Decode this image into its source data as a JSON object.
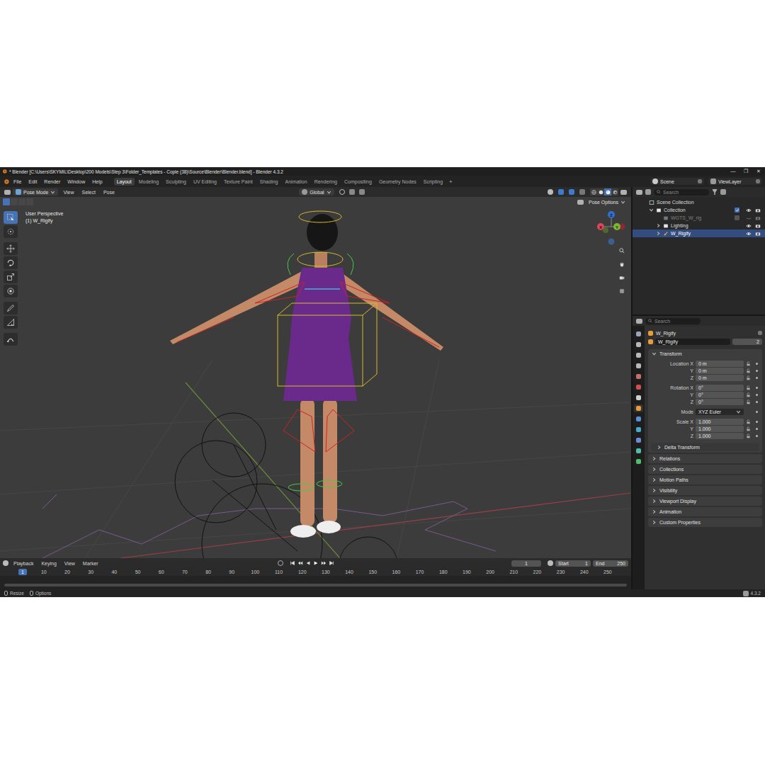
{
  "window": {
    "title": "* Blender [C:\\Users\\SKYMIL\\Desktop\\200 Models\\Step 3\\Folder_Templates - Copie (38)\\Source\\Blender\\Blender.blend] - Blender 4.3.2",
    "controls": [
      "—",
      "❐",
      "✕"
    ]
  },
  "menu": [
    "File",
    "Edit",
    "Render",
    "Window",
    "Help"
  ],
  "workspaces": [
    {
      "label": "Layout",
      "selected": true
    },
    {
      "label": "Modeling",
      "selected": false
    },
    {
      "label": "Sculpting",
      "selected": false
    },
    {
      "label": "UV Editing",
      "selected": false
    },
    {
      "label": "Texture Paint",
      "selected": false
    },
    {
      "label": "Shading",
      "selected": false
    },
    {
      "label": "Animation",
      "selected": false
    },
    {
      "label": "Rendering",
      "selected": false
    },
    {
      "label": "Compositing",
      "selected": false
    },
    {
      "label": "Geometry Nodes",
      "selected": false
    },
    {
      "label": "Scripting",
      "selected": false
    }
  ],
  "add_workspace": "+",
  "scene": "Scene",
  "view_layer": "ViewLayer",
  "viewport": {
    "mode": "Pose Mode",
    "menus": [
      "View",
      "Select",
      "Pose"
    ],
    "orientation": "Global",
    "tool_options": "Pose Options",
    "select_modes": [
      {
        "kind": "set",
        "selected": true
      },
      {
        "kind": "extend",
        "selected": false
      },
      {
        "kind": "subtract",
        "selected": false
      },
      {
        "kind": "intersect",
        "selected": false
      }
    ],
    "shading": [
      {
        "kind": "wireframe",
        "selected": false
      },
      {
        "kind": "solid",
        "selected": false
      },
      {
        "kind": "material",
        "selected": true
      },
      {
        "kind": "rendered",
        "selected": false
      }
    ],
    "overlay_view": "User Perspective",
    "overlay_object": "(1) W_Rigify",
    "gizmo": [
      "X",
      "Y",
      "Z"
    ],
    "tools": [
      {
        "kind": "select-box",
        "selected": true
      },
      {
        "kind": "cursor",
        "selected": false
      },
      {
        "kind": "move",
        "selected": false
      },
      {
        "kind": "rotate",
        "selected": false
      },
      {
        "kind": "scale",
        "selected": false
      },
      {
        "kind": "transform",
        "selected": false
      },
      {
        "kind": "annotate",
        "selected": false
      },
      {
        "kind": "measure",
        "selected": false
      },
      {
        "kind": "roll",
        "selected": false
      }
    ]
  },
  "timeline": {
    "menus": [
      "Playback",
      "Keying",
      "View",
      "Marker"
    ],
    "current": "1",
    "start_label": "Start",
    "start": "1",
    "end_label": "End",
    "end": "250",
    "ticks": [
      {
        "label": "1",
        "selected": true
      },
      {
        "label": "10",
        "selected": false
      },
      {
        "label": "20",
        "selected": false
      },
      {
        "label": "30",
        "selected": false
      },
      {
        "label": "40",
        "selected": false
      },
      {
        "label": "50",
        "selected": false
      },
      {
        "label": "60",
        "selected": false
      },
      {
        "label": "70",
        "selected": false
      },
      {
        "label": "80",
        "selected": false
      },
      {
        "label": "90",
        "selected": false
      },
      {
        "label": "100",
        "selected": false
      },
      {
        "label": "110",
        "selected": false
      },
      {
        "label": "120",
        "selected": false
      },
      {
        "label": "130",
        "selected": false
      },
      {
        "label": "140",
        "selected": false
      },
      {
        "label": "150",
        "selected": false
      },
      {
        "label": "160",
        "selected": false
      },
      {
        "label": "170",
        "selected": false
      },
      {
        "label": "180",
        "selected": false
      },
      {
        "label": "190",
        "selected": false
      },
      {
        "label": "200",
        "selected": false
      },
      {
        "label": "210",
        "selected": false
      },
      {
        "label": "220",
        "selected": false
      },
      {
        "label": "230",
        "selected": false
      },
      {
        "label": "240",
        "selected": false
      },
      {
        "label": "250",
        "selected": false
      }
    ]
  },
  "outliner": {
    "search": "Search",
    "items": [
      {
        "label": "Scene Collection",
        "kind": "scene",
        "depth": 0,
        "expandable": false,
        "expanded": true,
        "selected": false,
        "greyed": false,
        "has_checkbox": false,
        "checked": false,
        "has_toggles": false,
        "visible": true
      },
      {
        "label": "Collection",
        "kind": "collection",
        "depth": 1,
        "expandable": true,
        "expanded": true,
        "selected": false,
        "greyed": false,
        "has_checkbox": true,
        "checked": true,
        "has_toggles": true,
        "visible": true
      },
      {
        "label": "WGTS_W_rig",
        "kind": "collection",
        "depth": 2,
        "expandable": false,
        "expanded": false,
        "selected": false,
        "greyed": true,
        "has_checkbox": true,
        "checked": false,
        "has_toggles": true,
        "visible": false
      },
      {
        "label": "Lighting",
        "kind": "collection",
        "depth": 2,
        "expandable": true,
        "expanded": false,
        "selected": false,
        "greyed": false,
        "has_checkbox": false,
        "checked": false,
        "has_toggles": true,
        "visible": true
      },
      {
        "label": "W_Rigify",
        "kind": "armature",
        "depth": 2,
        "expandable": true,
        "expanded": false,
        "selected": true,
        "greyed": false,
        "has_checkbox": false,
        "checked": false,
        "has_toggles": true,
        "visible": true
      }
    ]
  },
  "properties": {
    "search": "Search",
    "object": "W_Rigify",
    "name": "W_Rigify",
    "users": "2",
    "tabs": [
      {
        "kind": "tool",
        "selected": false
      },
      {
        "kind": "render",
        "selected": false
      },
      {
        "kind": "output",
        "selected": false
      },
      {
        "kind": "view-layer",
        "selected": false
      },
      {
        "kind": "scene",
        "selected": false
      },
      {
        "kind": "world",
        "selected": false
      },
      {
        "kind": "collection",
        "selected": false
      },
      {
        "kind": "object",
        "selected": true
      },
      {
        "kind": "modifiers",
        "selected": false
      },
      {
        "kind": "physics",
        "selected": false
      },
      {
        "kind": "constraints",
        "selected": false
      },
      {
        "kind": "data",
        "selected": false
      },
      {
        "kind": "bone",
        "selected": false
      }
    ],
    "transform": {
      "title": "Transform",
      "expanded": true,
      "groups": [
        {
          "kind": "field",
          "rows": [
            {
              "label": "Location X",
              "value": "0 m"
            },
            {
              "label": "Y",
              "value": "0 m"
            },
            {
              "label": "Z",
              "value": "0 m"
            }
          ]
        },
        {
          "kind": "field",
          "rows": [
            {
              "label": "Rotation X",
              "value": "0°"
            },
            {
              "label": "Y",
              "value": "0°"
            },
            {
              "label": "Z",
              "value": "0°"
            }
          ]
        },
        {
          "kind": "dropdown",
          "rows": [
            {
              "label": "Mode",
              "value": "XYZ Euler"
            }
          ]
        },
        {
          "kind": "field",
          "rows": [
            {
              "label": "Scale X",
              "value": "1.000"
            },
            {
              "label": "Y",
              "value": "1.000"
            },
            {
              "label": "Z",
              "value": "1.000"
            }
          ]
        }
      ],
      "subpanels": [
        {
          "label": "Delta Transform",
          "expanded": false
        }
      ]
    },
    "panels": [
      {
        "label": "Relations",
        "expanded": false
      },
      {
        "label": "Collections",
        "expanded": false
      },
      {
        "label": "Motion Paths",
        "expanded": false
      },
      {
        "label": "Visibility",
        "expanded": false
      },
      {
        "label": "Viewport Display",
        "expanded": false
      },
      {
        "label": "Animation",
        "expanded": false
      },
      {
        "label": "Custom Properties",
        "expanded": false
      }
    ]
  },
  "status_bar": {
    "items": [
      "Resize",
      "Options"
    ],
    "version": "4.3.2"
  }
}
